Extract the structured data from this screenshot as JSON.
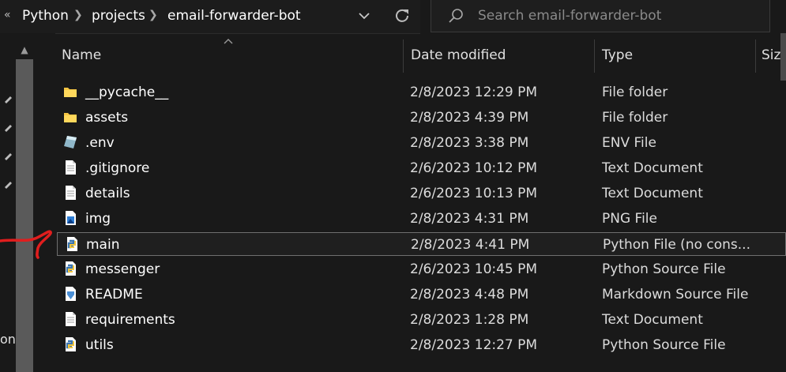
{
  "address": {
    "back_glyph": "«",
    "crumbs": [
      "Python",
      "projects",
      "email-forwarder-bot"
    ],
    "search_placeholder": "Search email-forwarder-bot"
  },
  "columns": {
    "name": "Name",
    "date": "Date modified",
    "type": "Type",
    "size": "Siz"
  },
  "files": [
    {
      "name": "__pycache__",
      "date": "2/8/2023 12:29 PM",
      "type": "File folder",
      "icon": "folder-icon"
    },
    {
      "name": "assets",
      "date": "2/8/2023 4:39 PM",
      "type": "File folder",
      "icon": "folder-icon"
    },
    {
      "name": ".env",
      "date": "2/8/2023 3:38 PM",
      "type": "ENV File",
      "icon": "env-file-icon"
    },
    {
      "name": ".gitignore",
      "date": "2/6/2023 10:12 PM",
      "type": "Text Document",
      "icon": "text-file-icon"
    },
    {
      "name": "details",
      "date": "2/6/2023 10:13 PM",
      "type": "Text Document",
      "icon": "text-file-icon"
    },
    {
      "name": "img",
      "date": "2/8/2023 4:31 PM",
      "type": "PNG File",
      "icon": "image-file-icon"
    },
    {
      "name": "main",
      "date": "2/8/2023 4:41 PM",
      "type": "Python File (no cons...",
      "icon": "python-file-icon",
      "selected": true
    },
    {
      "name": "messenger",
      "date": "2/6/2023 10:45 PM",
      "type": "Python Source File",
      "icon": "python-file-icon"
    },
    {
      "name": "README",
      "date": "2/8/2023 4:48 PM",
      "type": "Markdown Source File",
      "icon": "markdown-file-icon"
    },
    {
      "name": "requirements",
      "date": "2/8/2023 1:28 PM",
      "type": "Text Document",
      "icon": "text-file-icon"
    },
    {
      "name": "utils",
      "date": "2/8/2023 12:27 PM",
      "type": "Python Source File",
      "icon": "python-file-icon"
    }
  ],
  "left_partial_text": "on",
  "colors": {
    "background": "#191919",
    "annotation": "#e01e1e",
    "selection_border": "#6f6f6f"
  }
}
